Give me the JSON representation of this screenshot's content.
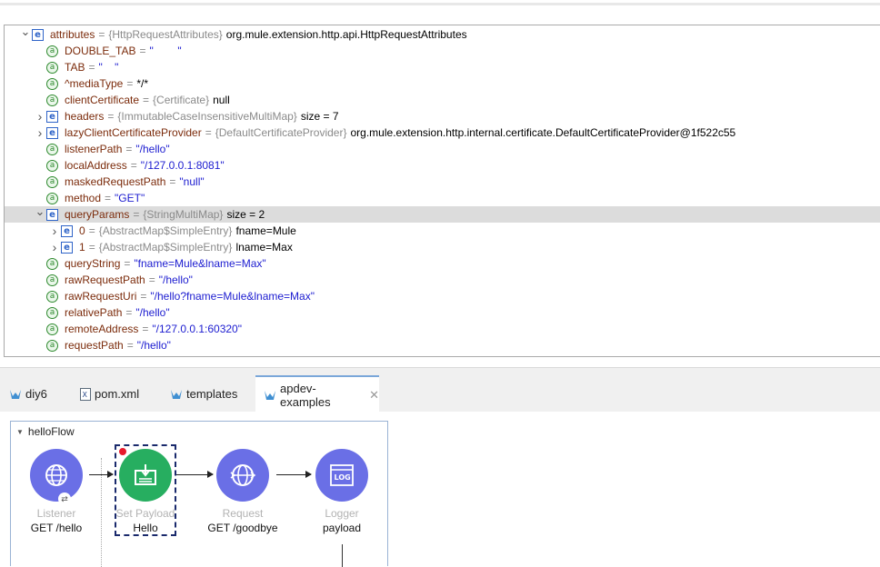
{
  "variables": [
    {
      "indent": 0,
      "twisty": "expanded",
      "icon": "e",
      "name": "attributes",
      "type": "{HttpRequestAttributes}",
      "value": "org.mule.extension.http.api.HttpRequestAttributes"
    },
    {
      "indent": 1,
      "twisty": "none",
      "icon": "a",
      "name": "DOUBLE_TAB",
      "str": "\"        \""
    },
    {
      "indent": 1,
      "twisty": "none",
      "icon": "a",
      "name": "TAB",
      "str": "\"    \""
    },
    {
      "indent": 1,
      "twisty": "none",
      "icon": "a",
      "name": "^mediaType",
      "plain": "*/*"
    },
    {
      "indent": 1,
      "twisty": "none",
      "icon": "a",
      "name": "clientCertificate",
      "type": "{Certificate}",
      "value": "null"
    },
    {
      "indent": 1,
      "twisty": "collapsed",
      "icon": "e",
      "name": "headers",
      "type": "{ImmutableCaseInsensitiveMultiMap}",
      "value": "size = 7"
    },
    {
      "indent": 1,
      "twisty": "collapsed",
      "icon": "e",
      "name": "lazyClientCertificateProvider",
      "type": "{DefaultCertificateProvider}",
      "value": "org.mule.extension.http.internal.certificate.DefaultCertificateProvider@1f522c55"
    },
    {
      "indent": 1,
      "twisty": "none",
      "icon": "a",
      "name": "listenerPath",
      "str": "\"/hello\""
    },
    {
      "indent": 1,
      "twisty": "none",
      "icon": "a",
      "name": "localAddress",
      "str": "\"/127.0.0.1:8081\""
    },
    {
      "indent": 1,
      "twisty": "none",
      "icon": "a",
      "name": "maskedRequestPath",
      "str": "\"null\""
    },
    {
      "indent": 1,
      "twisty": "none",
      "icon": "a",
      "name": "method",
      "str": "\"GET\""
    },
    {
      "indent": 1,
      "twisty": "expanded",
      "icon": "e",
      "name": "queryParams",
      "selected": true,
      "type": "{StringMultiMap}",
      "value": "size = 2"
    },
    {
      "indent": 2,
      "twisty": "collapsed",
      "icon": "e",
      "name": "0",
      "type": "{AbstractMap$SimpleEntry}",
      "value": "fname=Mule"
    },
    {
      "indent": 2,
      "twisty": "collapsed",
      "icon": "e",
      "name": "1",
      "type": "{AbstractMap$SimpleEntry}",
      "value": "lname=Max"
    },
    {
      "indent": 1,
      "twisty": "none",
      "icon": "a",
      "name": "queryString",
      "str": "\"fname=Mule&lname=Max\""
    },
    {
      "indent": 1,
      "twisty": "none",
      "icon": "a",
      "name": "rawRequestPath",
      "str": "\"/hello\""
    },
    {
      "indent": 1,
      "twisty": "none",
      "icon": "a",
      "name": "rawRequestUri",
      "str": "\"/hello?fname=Mule&lname=Max\""
    },
    {
      "indent": 1,
      "twisty": "none",
      "icon": "a",
      "name": "relativePath",
      "str": "\"/hello\""
    },
    {
      "indent": 1,
      "twisty": "none",
      "icon": "a",
      "name": "remoteAddress",
      "str": "\"/127.0.0.1:60320\""
    },
    {
      "indent": 1,
      "twisty": "none",
      "icon": "a",
      "name": "requestPath",
      "str": "\"/hello\""
    }
  ],
  "tabs": [
    {
      "label": "diy6",
      "icon": "mule-icon"
    },
    {
      "label": "pom.xml",
      "icon": "xml-file-icon"
    },
    {
      "label": "templates",
      "icon": "mule-icon"
    },
    {
      "label": "apdev-examples",
      "icon": "mule-icon",
      "active": true,
      "closable": true
    }
  ],
  "flow": {
    "name": "helloFlow",
    "components": [
      {
        "label": "Listener",
        "sub": "GET /hello",
        "icon": "globe-icon",
        "color": "#6a6fe6"
      },
      {
        "label": "Set Payload",
        "sub": "Hello",
        "icon": "set-payload-icon",
        "color": "#27ae60",
        "breakpoint": true,
        "selected": true
      },
      {
        "label": "Request",
        "sub": "GET /goodbye",
        "icon": "http-request-icon",
        "color": "#6a6fe6"
      },
      {
        "label": "Logger",
        "sub": "payload",
        "icon": "logger-icon",
        "color": "#6a6fe6"
      }
    ]
  }
}
